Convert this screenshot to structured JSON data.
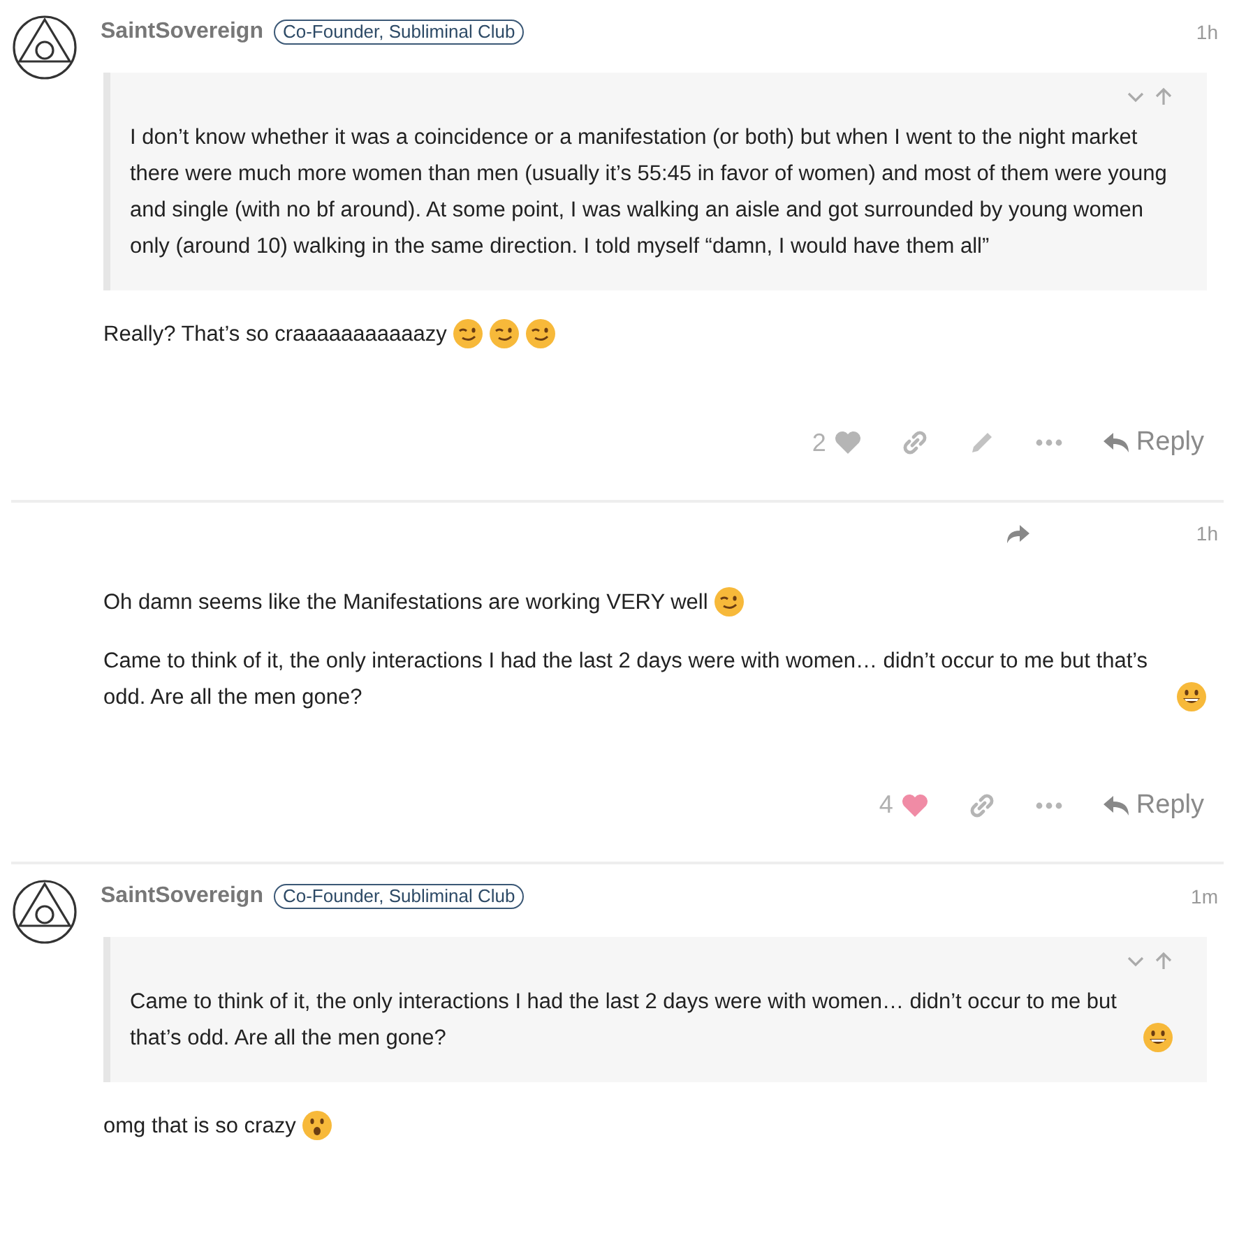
{
  "posts": [
    {
      "author": {
        "name": "SaintSovereign",
        "badge": "Co-Founder, Subliminal Club"
      },
      "time": "1h",
      "quote": {
        "text": "I don’t know whether it was a coincidence or a manifestation (or both) but when I went to the night market there were much more women than men (usually it’s 55:45 in favor of women) and most of them were young and single (with no bf around). At some point, I was walking an aisle and got surrounded by young women only (around 10) walking in the same direction. I told myself “damn, I would have them all”"
      },
      "paragraphs": [
        {
          "text": "Really? That’s so craaaaaaaaaaazy",
          "emoji": [
            {
              "kind": "wink"
            },
            {
              "kind": "wink"
            },
            {
              "kind": "wink"
            }
          ]
        }
      ],
      "likes": "2",
      "liked": false,
      "actions": [
        {
          "kind": "link"
        },
        {
          "kind": "edit"
        },
        {
          "kind": "more"
        }
      ],
      "reply": "Reply"
    },
    {
      "header_icons": [
        {
          "kind": "share"
        }
      ],
      "time": "1h",
      "paragraphs": [
        {
          "text": "Oh damn seems like the Manifestations are working VERY well",
          "emoji": [
            {
              "kind": "wink"
            }
          ]
        },
        {
          "text": "Came to think of it, the only interactions I had the last 2 days were with women… didn’t occur to me but that’s odd. Are all the men gone?",
          "emoji": [
            {
              "kind": "grin"
            }
          ]
        }
      ],
      "likes": "4",
      "liked": true,
      "actions": [
        {
          "kind": "link"
        },
        {
          "kind": "more"
        }
      ],
      "reply": "Reply"
    },
    {
      "author": {
        "name": "SaintSovereign",
        "badge": "Co-Founder, Subliminal Club"
      },
      "time": "1m",
      "quote": {
        "text": "Came to think of it, the only interactions I had the last 2 days were with women… didn’t occur to me but that’s odd. Are all the men gone?",
        "emoji": [
          {
            "kind": "grin"
          }
        ]
      },
      "paragraphs": [
        {
          "text": "omg that is so crazy",
          "emoji": [
            {
              "kind": "wow"
            }
          ]
        }
      ]
    }
  ]
}
